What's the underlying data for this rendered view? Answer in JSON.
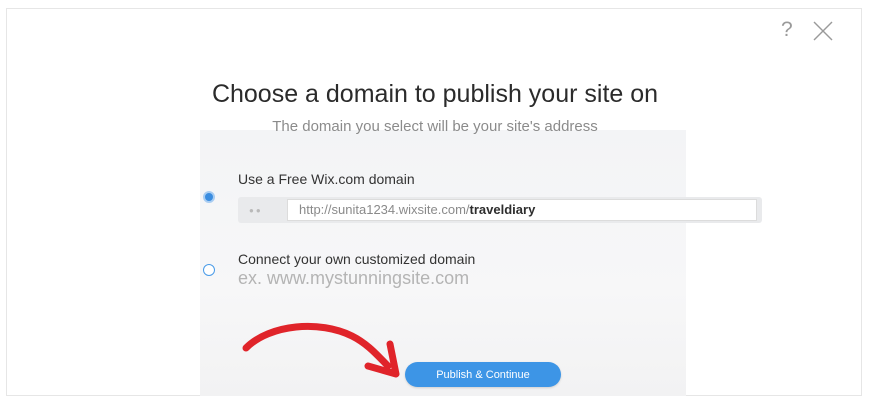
{
  "dialog": {
    "help_label": "?",
    "title": "Choose a domain to publish your site on",
    "subtitle": "The domain you select will be your site's address"
  },
  "options": {
    "free": {
      "label": "Use a Free Wix.com domain",
      "selected": true,
      "url_prefix": "http://sunita1234.wixsite.com/",
      "url_site": "traveldiary",
      "dots": "●●"
    },
    "custom": {
      "label": "Connect your own customized domain",
      "selected": false,
      "placeholder": "ex. www.mystunningsite.com"
    }
  },
  "actions": {
    "publish_label": "Publish & Continue"
  },
  "colors": {
    "accent": "#3d95e6",
    "annotation_arrow": "#e0242a"
  },
  "icons": {
    "close": "close-icon",
    "help": "help-icon",
    "annotation": "red-arrow-annotation"
  }
}
